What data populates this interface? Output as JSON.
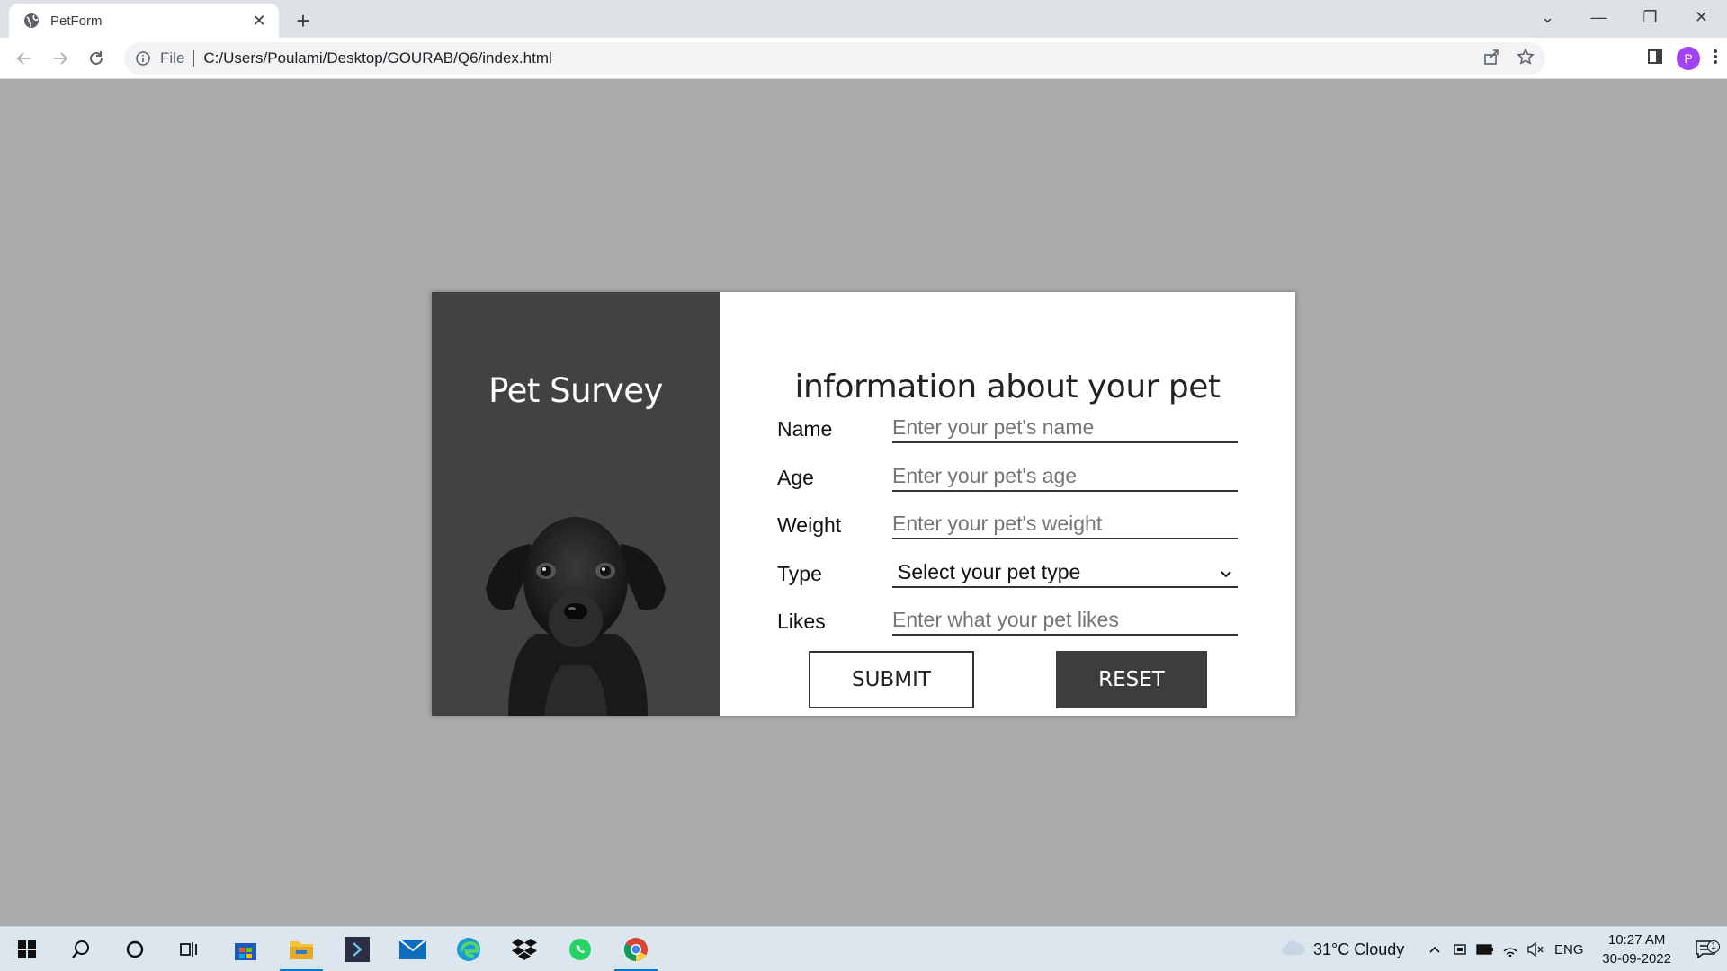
{
  "browser": {
    "tab_title": "PetForm",
    "scheme_label": "File",
    "url": "C:/Users/Poulami/Desktop/GOURAB/Q6/index.html",
    "profile_initial": "P"
  },
  "page": {
    "survey_title": "Pet Survey",
    "form_heading": "information about your pet",
    "fields": {
      "name": {
        "label": "Name",
        "placeholder": "Enter your pet's name"
      },
      "age": {
        "label": "Age",
        "placeholder": "Enter your pet's age"
      },
      "weight": {
        "label": "Weight",
        "placeholder": "Enter your pet's weight"
      },
      "type": {
        "label": "Type",
        "selected": "Select your pet type"
      },
      "likes": {
        "label": "Likes",
        "placeholder": "Enter what your pet likes"
      }
    },
    "submit_label": "SUBMIT",
    "reset_label": "RESET"
  },
  "taskbar": {
    "weather": "31°C  Cloudy",
    "language": "ENG",
    "time": "10:27 AM",
    "date": "30-09-2022",
    "notification_count": "1"
  },
  "colors": {
    "page_bg": "#ababab",
    "left_panel": "#424242",
    "reset_button": "#3d3d3d"
  }
}
